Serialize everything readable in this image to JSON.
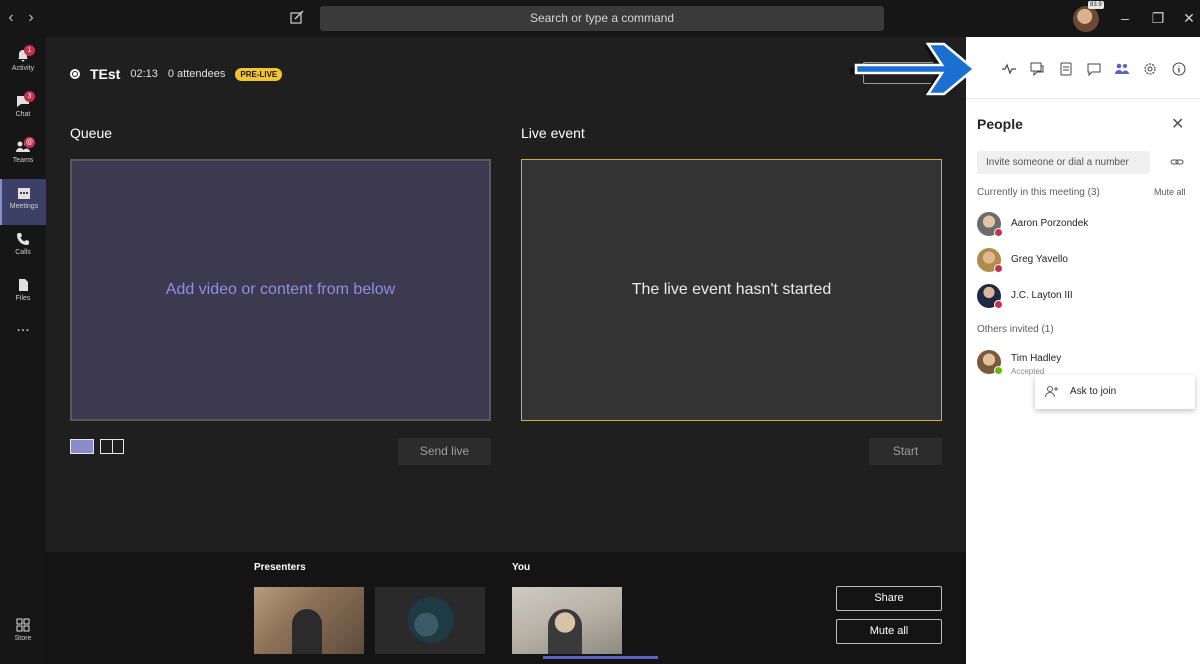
{
  "titlebar": {
    "search_placeholder": "Search or type a command",
    "user_badge": "83.9"
  },
  "rail": {
    "items": [
      {
        "label": "Activity",
        "badge": "1"
      },
      {
        "label": "Chat",
        "badge": "3"
      },
      {
        "label": "Teams",
        "badge": "@"
      },
      {
        "label": "Meetings",
        "badge": ""
      },
      {
        "label": "Calls",
        "badge": ""
      },
      {
        "label": "Files",
        "badge": ""
      },
      {
        "label": "...",
        "badge": ""
      },
      {
        "label": "Store",
        "badge": ""
      }
    ]
  },
  "event": {
    "title": "TEst",
    "time": "02:13",
    "attendees": "0 attendees",
    "status": "PRE-LIVE"
  },
  "queue": {
    "title": "Queue",
    "placeholder": "Add video or content from below",
    "send_live_label": "Send live"
  },
  "live": {
    "title": "Live event",
    "message": "The live event hasn't started",
    "start_label": "Start"
  },
  "bottom": {
    "presenters_label": "Presenters",
    "you_label": "You",
    "share_label": "Share",
    "mute_all_label": "Mute all"
  },
  "people": {
    "title": "People",
    "invite_placeholder": "Invite someone or dial a number",
    "current_header": "Currently in this meeting (3)",
    "mute_all": "Mute all",
    "current": [
      {
        "name": "Aaron Porzondek",
        "status_color": "#c4314b"
      },
      {
        "name": "Greg Yavello",
        "status_color": "#c4314b"
      },
      {
        "name": "J.C. Layton III",
        "status_color": "#c4314b"
      }
    ],
    "invited_header": "Others invited (1)",
    "invited": [
      {
        "name": "Tim Hadley",
        "sub": "Accepted",
        "status_color": "#6bb700"
      }
    ],
    "ask_to_join": "Ask to join"
  },
  "colors": {
    "accent": "#5b5fc7",
    "prelive": "#f3c332",
    "live_border": "#d9a93a",
    "arrow": "#1a6fd0"
  }
}
